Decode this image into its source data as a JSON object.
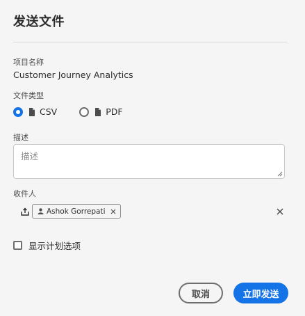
{
  "dialog": {
    "title": "发送文件"
  },
  "project": {
    "label": "项目名称",
    "value": "Customer Journey Analytics"
  },
  "file_type": {
    "label": "文件类型",
    "options": [
      {
        "label": "CSV",
        "checked": true,
        "icon": "file-icon"
      },
      {
        "label": "PDF",
        "checked": false,
        "icon": "file-icon"
      }
    ]
  },
  "description": {
    "label": "描述",
    "placeholder": "描述",
    "value": ""
  },
  "recipients": {
    "label": "收件人",
    "upload_icon": "upload-icon",
    "tags": [
      {
        "name": "Ashok Gorrepati",
        "icon": "user-icon"
      }
    ],
    "clear_icon": "close-icon"
  },
  "schedule": {
    "label": "显示计划选项",
    "checked": false
  },
  "buttons": {
    "cancel": "取消",
    "send": "立即发送"
  },
  "colors": {
    "accent": "#1473e6",
    "background": "#f5f5f5"
  }
}
